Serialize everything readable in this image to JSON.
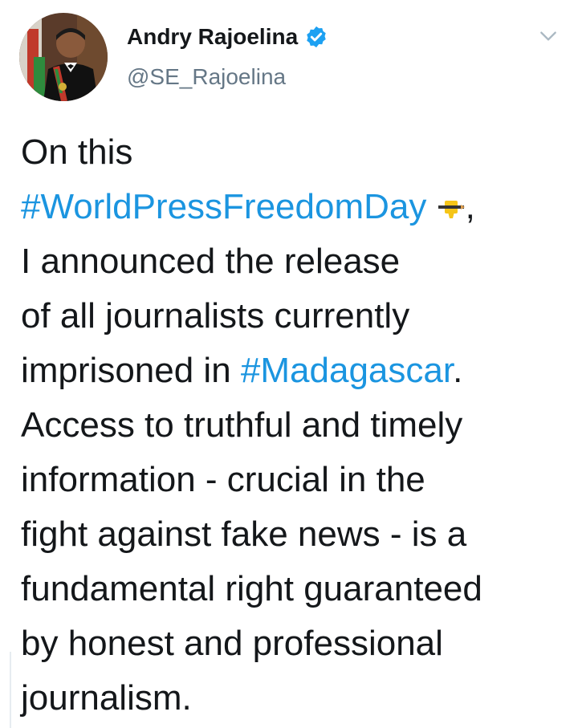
{
  "user": {
    "name": "Andry Rajoelina",
    "handle": "@SE_Rajoelina"
  },
  "tweet": {
    "l1": "On this",
    "hashtag1": "#WorldPressFreedomDay",
    "l2_tail": ",",
    "l3": "I announced the release",
    "l4": "of all journalists currently",
    "l5_pre": "imprisoned in ",
    "hashtag2": "#Madagascar",
    "l5_tail": ".",
    "l6": "Access to truthful and timely",
    "l7": "information - crucial in the",
    "l8": "fight against fake news - is a",
    "l9": "fundamental right guaranteed",
    "l10": "by honest and professional",
    "l11": "journalism."
  },
  "colors": {
    "link": "#1b95e0",
    "verified": "#1da1f2",
    "secondary": "#657786",
    "text": "#14171a"
  },
  "icons": {
    "verified": "verified-badge-icon",
    "menu": "chevron-down-icon",
    "emoji": "newspaper-pencil-emoji"
  }
}
